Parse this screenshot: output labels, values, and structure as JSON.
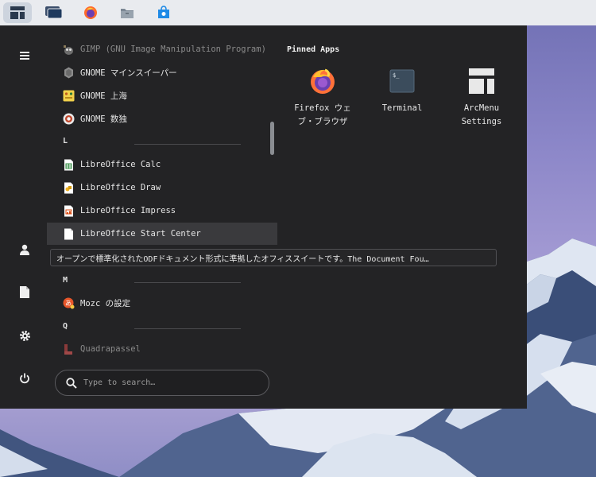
{
  "taskbar": {
    "items": [
      {
        "icon": "arcmenu-icon",
        "active": true
      },
      {
        "icon": "workspaces-icon",
        "active": false
      },
      {
        "icon": "firefox-icon",
        "active": false
      },
      {
        "icon": "files-icon",
        "active": false
      },
      {
        "icon": "software-icon",
        "active": false
      }
    ]
  },
  "sidebar": {
    "items": [
      "hamburger-icon",
      "user-icon",
      "document-icon",
      "settings-icon",
      "power-icon"
    ]
  },
  "applist": {
    "items": [
      {
        "type": "app",
        "label": "GIMP (GNU Image Manipulation Program)",
        "icon": "gimp-icon",
        "dim": true
      },
      {
        "type": "app",
        "label": "GNOME マインスイーパー",
        "icon": "mines-icon"
      },
      {
        "type": "app",
        "label": "GNOME 上海",
        "icon": "mahjongg-icon"
      },
      {
        "type": "app",
        "label": "GNOME 数独",
        "icon": "sudoku-icon"
      },
      {
        "type": "section",
        "label": "L"
      },
      {
        "type": "app",
        "label": "LibreOffice Calc",
        "icon": "calc-icon"
      },
      {
        "type": "app",
        "label": "LibreOffice Draw",
        "icon": "draw-icon"
      },
      {
        "type": "app",
        "label": "LibreOffice Impress",
        "icon": "impress-icon"
      },
      {
        "type": "app",
        "label": "LibreOffice Start Center",
        "icon": "startcenter-icon",
        "selected": true
      },
      {
        "type": "section",
        "label": "M"
      },
      {
        "type": "app",
        "label": "Mozc の設定",
        "icon": "mozc-icon"
      },
      {
        "type": "section",
        "label": "Q"
      },
      {
        "type": "app",
        "label": "Quadrapassel",
        "icon": "quadrapassel-icon",
        "dim": true
      }
    ]
  },
  "search": {
    "placeholder": "Type to search…"
  },
  "pinned": {
    "title": "Pinned Apps",
    "apps": [
      {
        "label": "Firefox ウェブ・ブラウザ",
        "icon": "firefox-icon"
      },
      {
        "label": "Terminal",
        "icon": "terminal-icon"
      },
      {
        "label": "ArcMenu Settings",
        "icon": "arcmenu-settings-icon"
      }
    ]
  },
  "tooltip": {
    "text": "オープンで標準化されたODFドキュメント形式に準拠したオフィススイートです。The Document Fou…"
  },
  "colors": {
    "menu_bg": "#232325",
    "panel_bg": "#e9ebef",
    "accent": "#1d6fd1"
  }
}
